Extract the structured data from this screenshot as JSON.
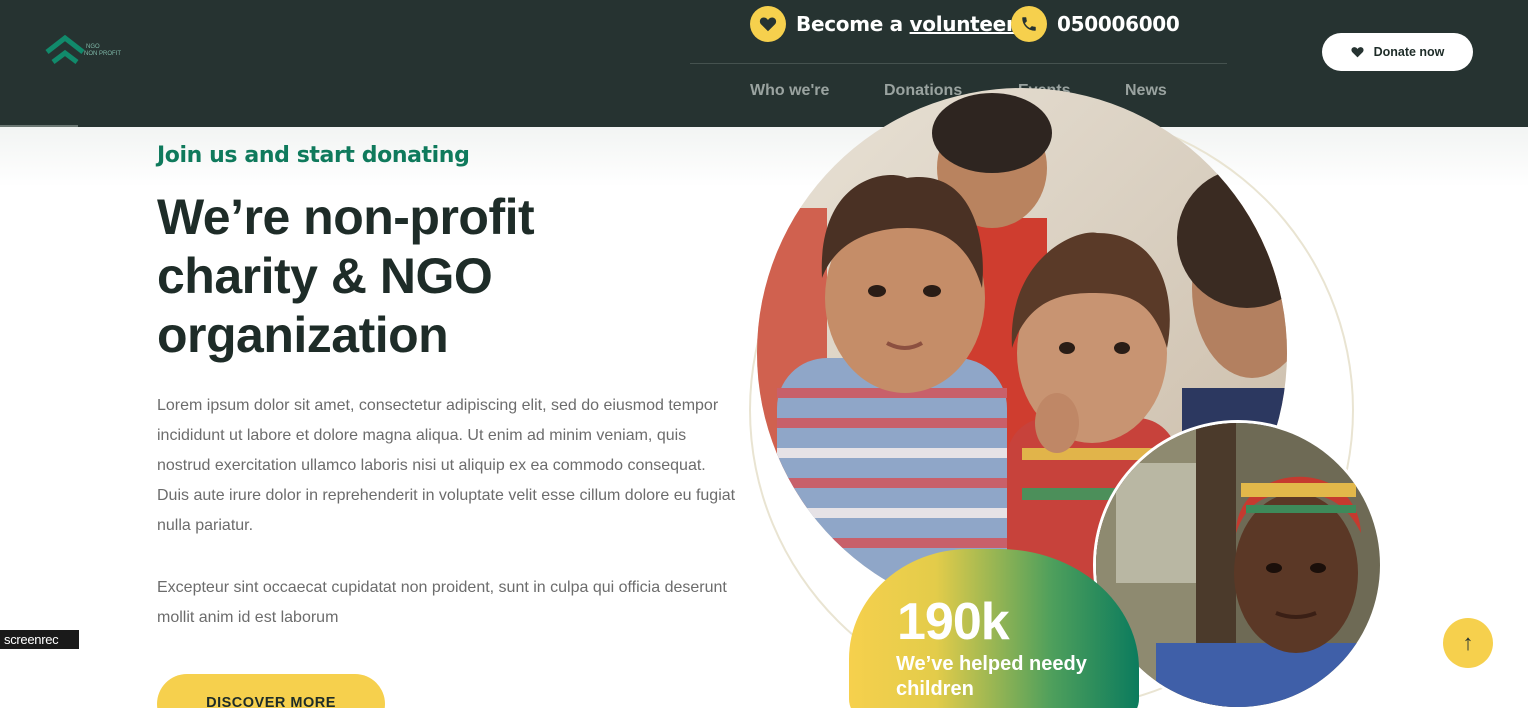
{
  "header": {
    "logo_line1": "NGO",
    "logo_line2": "NON PROFIT",
    "volunteer_prefix": "Become a",
    "volunteer_link": "volunteer",
    "phone": "050006000",
    "donate_label": "Donate now",
    "nav": [
      "Who we're",
      "Donations",
      "Events",
      "News"
    ]
  },
  "hero": {
    "kicker": "Join us and start donating",
    "title_lines": [
      "We’re non-profit",
      "charity & NGO",
      "organization"
    ],
    "paragraph1": "Lorem ipsum dolor sit amet, consectetur adipiscing elit, sed do eiusmod tempor incididunt ut labore et dolore magna aliqua. Ut enim ad minim veniam, quis nostrud exercitation ullamco laboris nisi ut aliquip ex ea commodo consequat. Duis aute irure dolor in reprehenderit in voluptate velit esse cillum dolore eu fugiat nulla pariatur.",
    "paragraph2": "Excepteur sint occaecat cupidatat non proident, sunt in culpa qui officia deserunt mollit anim id est laborum",
    "cta_label": "DISCOVER MORE"
  },
  "stat": {
    "number": "190k",
    "label": "We’ve helped needy children"
  },
  "overlay": {
    "screenrec": "screenrec",
    "scroll_top": "↑"
  },
  "colors": {
    "header_bg": "#263331",
    "accent_yellow": "#f6d04d",
    "accent_green": "#0b7b5d",
    "text_dark": "#1e2c28"
  }
}
